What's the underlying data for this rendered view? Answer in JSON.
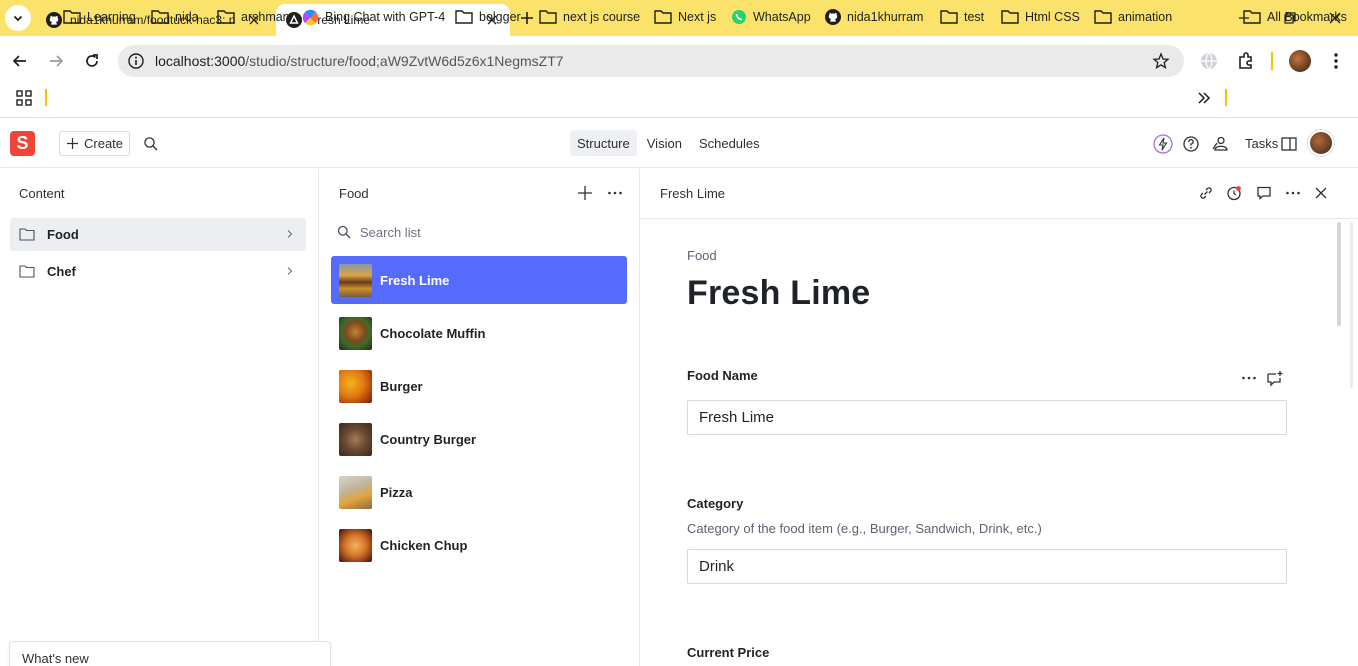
{
  "browser": {
    "tabs": [
      {
        "title": "nida1khurram/foodtuck-hac3: n",
        "icon": "github-icon",
        "active": false
      },
      {
        "title": "Fresh Lime",
        "icon": "sanity-triangle-icon",
        "active": true
      }
    ],
    "url_host": "localhost:3000",
    "url_path": "/studio/structure/food;aW9ZvtW6d5z6x1NegmsZT7",
    "bookmarks": [
      "Learning",
      "nida",
      "arshman",
      "Bing Chat with GPT-4",
      "bolgger",
      "next js course",
      "Next js",
      "WhatsApp",
      "nida1khurram",
      "test",
      "Html CSS",
      "animation"
    ],
    "all_bookmarks": "All Bookmarks",
    "accent": "#fbe26a"
  },
  "studio": {
    "logo_letter": "S",
    "create_label": "Create",
    "nav": [
      "Structure",
      "Vision",
      "Schedules"
    ],
    "tasks_label": "Tasks"
  },
  "content_pane": {
    "title": "Content",
    "items": [
      {
        "label": "Food",
        "selected": true
      },
      {
        "label": "Chef",
        "selected": false
      }
    ],
    "whats_new": "What's new"
  },
  "food_pane": {
    "title": "Food",
    "search_placeholder": "Search list",
    "items": [
      {
        "label": "Fresh Lime",
        "selected": true
      },
      {
        "label": "Chocolate Muffin",
        "selected": false
      },
      {
        "label": "Burger",
        "selected": false
      },
      {
        "label": "Country Burger",
        "selected": false
      },
      {
        "label": "Pizza",
        "selected": false
      },
      {
        "label": "Chicken Chup",
        "selected": false
      }
    ],
    "selected_color": "#556bfc"
  },
  "document": {
    "header_title": "Fresh Lime",
    "type_label": "Food",
    "title": "Fresh Lime",
    "fields": {
      "food_name": {
        "label": "Food Name",
        "value": "Fresh Lime"
      },
      "category": {
        "label": "Category",
        "description": "Category of the food item (e.g., Burger, Sandwich, Drink, etc.)",
        "value": "Drink"
      },
      "current_price": {
        "label": "Current Price"
      }
    }
  }
}
